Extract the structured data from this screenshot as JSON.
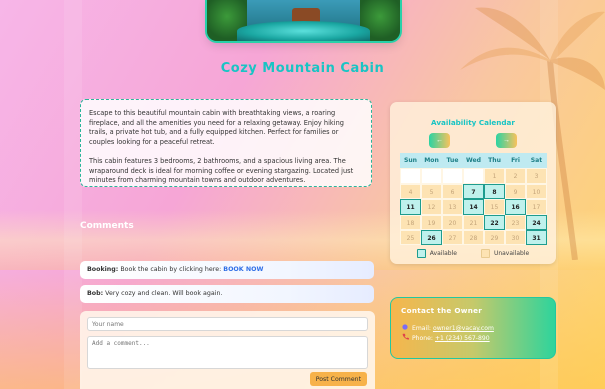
{
  "title": "Cozy Mountain Cabin",
  "description": {
    "p1": "Escape to this beautiful mountain cabin with breathtaking views, a roaring fireplace, and all the amenities you need for a relaxing getaway. Enjoy hiking trails, a private hot tub, and a fully equipped kitchen. Perfect for families or couples looking for a peaceful retreat.",
    "p2": "This cabin features 3 bedrooms, 2 bathrooms, and a spacious living area. The wraparound deck is ideal for morning coffee or evening stargazing. Located just minutes from charming mountain towns and outdoor adventures."
  },
  "comments": {
    "heading": "Comments",
    "items": [
      {
        "author": "Booking:",
        "text": "Book the cabin by clicking here:",
        "link": "BOOK NOW"
      },
      {
        "author": "Bob:",
        "text": "Very cozy and clean. Will book again."
      }
    ],
    "form": {
      "name_placeholder": "Your name",
      "comment_placeholder": "Add a comment...",
      "post_label": "Post Comment"
    }
  },
  "calendar": {
    "title": "Availability Calendar",
    "prev_label": "←",
    "next_label": "→",
    "weekdays": [
      "Sun",
      "Mon",
      "Tue",
      "Wed",
      "Thu",
      "Fri",
      "Sat"
    ],
    "legend_available": "Available",
    "legend_unavailable": "Unavailable",
    "days": [
      {
        "n": "",
        "s": "blank"
      },
      {
        "n": "",
        "s": "blank"
      },
      {
        "n": "",
        "s": "blank"
      },
      {
        "n": "",
        "s": "blank"
      },
      {
        "n": "1",
        "s": "u"
      },
      {
        "n": "2",
        "s": "u"
      },
      {
        "n": "3",
        "s": "u"
      },
      {
        "n": "4",
        "s": "u"
      },
      {
        "n": "5",
        "s": "u"
      },
      {
        "n": "6",
        "s": "u"
      },
      {
        "n": "7",
        "s": "av"
      },
      {
        "n": "8",
        "s": "av"
      },
      {
        "n": "9",
        "s": "u"
      },
      {
        "n": "10",
        "s": "u"
      },
      {
        "n": "11",
        "s": "av"
      },
      {
        "n": "12",
        "s": "u"
      },
      {
        "n": "13",
        "s": "u"
      },
      {
        "n": "14",
        "s": "av"
      },
      {
        "n": "15",
        "s": "u"
      },
      {
        "n": "16",
        "s": "av"
      },
      {
        "n": "17",
        "s": "u"
      },
      {
        "n": "18",
        "s": "u"
      },
      {
        "n": "19",
        "s": "u"
      },
      {
        "n": "20",
        "s": "u"
      },
      {
        "n": "21",
        "s": "u"
      },
      {
        "n": "22",
        "s": "av"
      },
      {
        "n": "23",
        "s": "u"
      },
      {
        "n": "24",
        "s": "av"
      },
      {
        "n": "25",
        "s": "u"
      },
      {
        "n": "26",
        "s": "av"
      },
      {
        "n": "27",
        "s": "u"
      },
      {
        "n": "28",
        "s": "u"
      },
      {
        "n": "29",
        "s": "u"
      },
      {
        "n": "30",
        "s": "u"
      },
      {
        "n": "31",
        "s": "av"
      }
    ]
  },
  "contact": {
    "heading": "Contact the Owner",
    "email_label": "Email:",
    "email": "owner1@vacay.com",
    "phone_label": "Phone:",
    "phone": "+1 (234) 567-890",
    "email_icon": "email-icon",
    "phone_icon": "phone-icon"
  },
  "colors": {
    "accent": "#19c4c4",
    "available": "#bff1ec",
    "unavailable": "#fde3b3",
    "post_button": "#f7b24a"
  }
}
